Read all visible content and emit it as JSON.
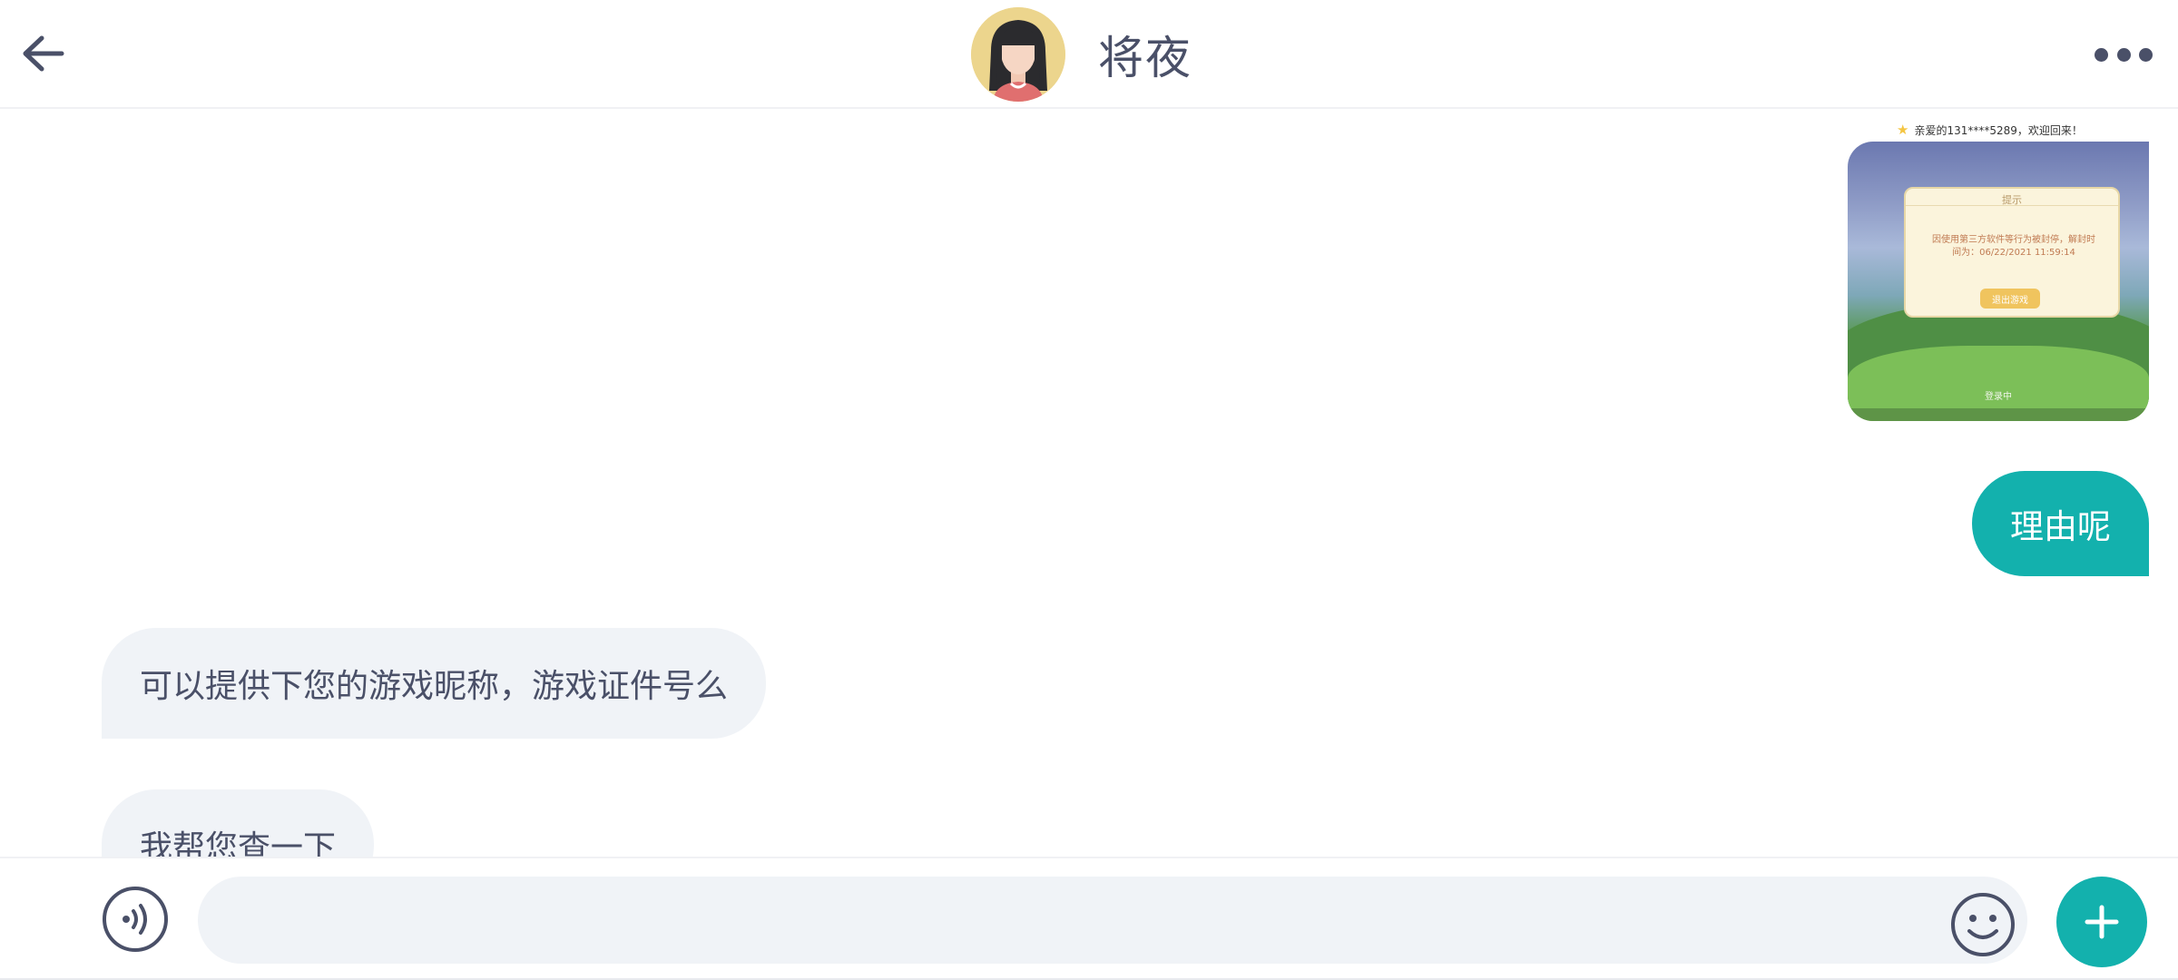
{
  "header": {
    "title": "将夜",
    "back_icon": "arrow-left-icon",
    "more_icon": "more-dots-icon",
    "avatar_icon": "girl-avatar-icon"
  },
  "messages": {
    "image_message": {
      "toast_text": "亲爱的131****5289，欢迎回来！",
      "dialog_title": "提示",
      "dialog_body_line1": "因使用第三方软件等行为被封停，解封时",
      "dialog_body_line2": "间为：06/22/2021 11:59:14",
      "dialog_button": "退出游戏",
      "loading_text": "登录中"
    },
    "outgoing_1": "理由呢",
    "incoming_1": "可以提供下您的游戏昵称，游戏证件号么",
    "incoming_2": "我帮您查一下"
  },
  "composer": {
    "input_value": "",
    "voice_icon": "voice-icon",
    "emoji_icon": "emoji-icon",
    "plus_icon": "plus-icon"
  },
  "colors": {
    "accent": "#13b1ad",
    "text": "#4a5068",
    "bubble_in": "#f0f3f7",
    "avatar_bg": "#ecd58d"
  }
}
